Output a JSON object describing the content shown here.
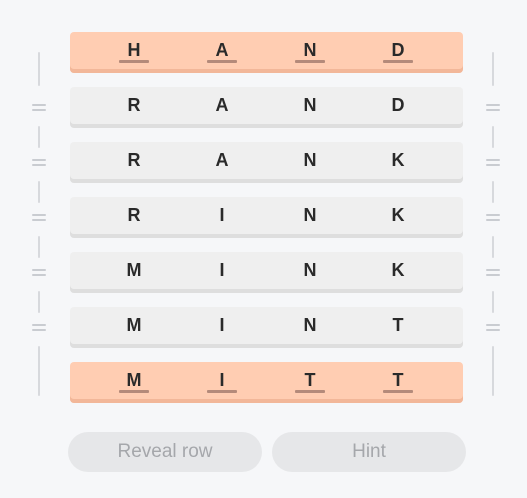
{
  "rows": [
    {
      "letters": [
        "H",
        "A",
        "N",
        "D"
      ],
      "fixed": true
    },
    {
      "letters": [
        "R",
        "A",
        "N",
        "D"
      ],
      "fixed": false
    },
    {
      "letters": [
        "R",
        "A",
        "N",
        "K"
      ],
      "fixed": false
    },
    {
      "letters": [
        "R",
        "I",
        "N",
        "K"
      ],
      "fixed": false
    },
    {
      "letters": [
        "M",
        "I",
        "N",
        "K"
      ],
      "fixed": false
    },
    {
      "letters": [
        "M",
        "I",
        "N",
        "T"
      ],
      "fixed": false
    },
    {
      "letters": [
        "M",
        "I",
        "T",
        "T"
      ],
      "fixed": true
    }
  ],
  "buttons": {
    "reveal_row": "Reveal row",
    "hint": "Hint"
  },
  "colors": {
    "fixed_row": "#ffcdb2",
    "row": "#efefef",
    "button": "#e6e7e9"
  }
}
